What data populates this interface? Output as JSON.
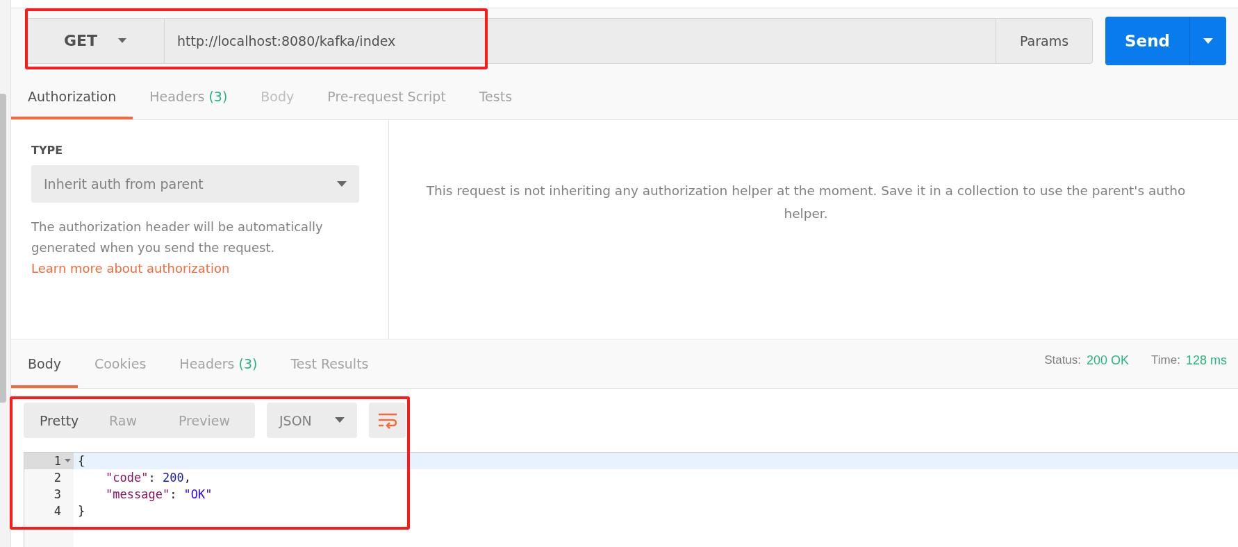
{
  "request": {
    "method": "GET",
    "url": "http://localhost:8080/kafka/index",
    "params_button": "Params",
    "send_button": "Send"
  },
  "request_tabs": [
    {
      "label": "Authorization",
      "selected": true,
      "disabled": false
    },
    {
      "label": "Headers",
      "count": "(3)",
      "selected": false,
      "disabled": false
    },
    {
      "label": "Body",
      "selected": false,
      "disabled": true
    },
    {
      "label": "Pre-request Script",
      "selected": false,
      "disabled": false
    },
    {
      "label": "Tests",
      "selected": false,
      "disabled": false
    }
  ],
  "auth": {
    "type_label": "TYPE",
    "type_value": "Inherit auth from parent",
    "description": "The authorization header will be automatically generated when you send the request.",
    "link": "Learn more about authorization",
    "message_lines": [
      "This request is not inheriting any authorization helper at the moment. Save it in a collection to use the parent's autho",
      "helper."
    ]
  },
  "response_tabs": [
    {
      "label": "Body",
      "selected": true
    },
    {
      "label": "Cookies",
      "selected": false
    },
    {
      "label": "Headers",
      "count": "(3)",
      "selected": false
    },
    {
      "label": "Test Results",
      "selected": false
    }
  ],
  "status": {
    "status_label": "Status:",
    "status_value": "200 OK",
    "time_label": "Time:",
    "time_value": "128 ms"
  },
  "view_modes": [
    {
      "label": "Pretty",
      "selected": true
    },
    {
      "label": "Raw",
      "selected": false
    },
    {
      "label": "Preview",
      "selected": false
    }
  ],
  "format": "JSON",
  "code_lines": [
    {
      "number": "1",
      "foldable": true,
      "active": true,
      "indented": false,
      "tokens": [
        {
          "kind": "punct",
          "text": "{"
        }
      ]
    },
    {
      "number": "2",
      "foldable": false,
      "active": false,
      "indented": true,
      "tokens": [
        {
          "kind": "key",
          "text": "\"code\""
        },
        {
          "kind": "punct",
          "text": ": "
        },
        {
          "kind": "number",
          "text": "200"
        },
        {
          "kind": "punct",
          "text": ","
        }
      ]
    },
    {
      "number": "3",
      "foldable": false,
      "active": false,
      "indented": true,
      "tokens": [
        {
          "kind": "key",
          "text": "\"message\""
        },
        {
          "kind": "punct",
          "text": ": "
        },
        {
          "kind": "string",
          "text": "\"OK\""
        }
      ]
    },
    {
      "number": "4",
      "foldable": false,
      "active": false,
      "indented": false,
      "tokens": [
        {
          "kind": "punct",
          "text": "}"
        }
      ]
    }
  ]
}
